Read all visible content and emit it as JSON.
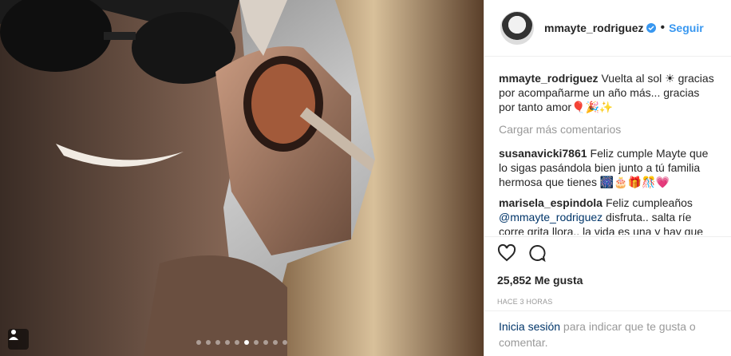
{
  "media": {
    "alt_icons": [
      "carousel-icon"
    ],
    "dots_total": 10,
    "dots_active": 5
  },
  "header": {
    "username": "mmayte_rodriguez",
    "separator": "•",
    "follow_label": "Seguir"
  },
  "caption": {
    "user": "mmayte_rodriguez",
    "text": "Vuelta al sol ☀ gracias por acompañarme un año más... gracias por tanto amor🎈🎉✨"
  },
  "load_more_label": "Cargar más comentarios",
  "comments": [
    {
      "user": "susanavicki7861",
      "text": "Feliz cumple Mayte que lo sigas pasándola bien junto a tú familia hermosa que tienes 🎆🎂🎁🎊💗"
    },
    {
      "user": "marisela_espindola",
      "text_before": "Feliz cumpleaños ",
      "mention": "@mmayte_rodriguez",
      "text_after": " disfruta.. salta ríe corre grita llora.. la vida es una y hay que"
    }
  ],
  "likes": "25,852 Me gusta",
  "time": "HACE 3 HORAS",
  "login": {
    "link": "Inicia sesión",
    "rest": " para indicar que te gusta o comentar."
  },
  "colors": {
    "accent": "#3897f0",
    "mention": "#003569",
    "muted": "#999999"
  }
}
